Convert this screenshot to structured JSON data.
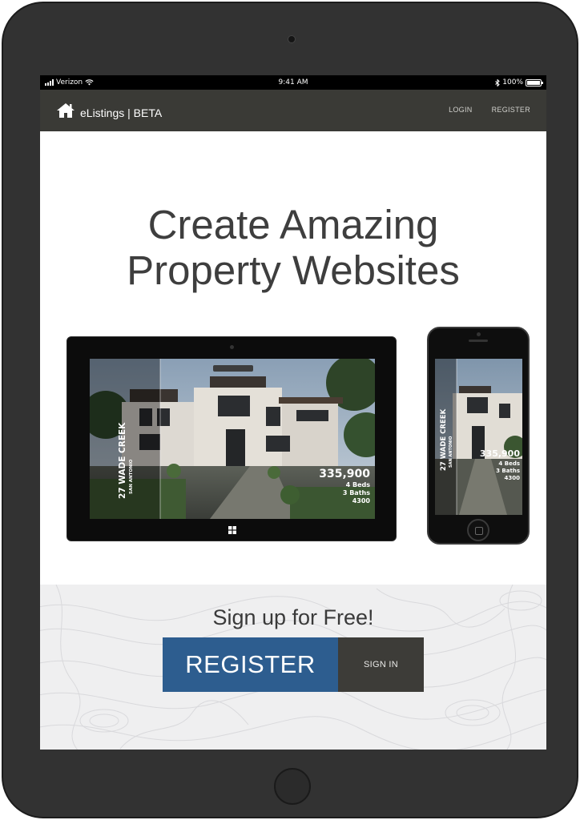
{
  "status_bar": {
    "carrier": "Verizon",
    "time": "9:41 AM",
    "battery": "100%",
    "battery_level": 1.0
  },
  "navbar": {
    "brand": "eListings | BETA",
    "brand_icon": "home-icon",
    "links": [
      "LOGIN",
      "REGISTER"
    ]
  },
  "hero": {
    "title_line1": "Create Amazing",
    "title_line2": "Property Websites"
  },
  "listing_preview": {
    "address": "27 WADE CREEK",
    "city": "SAN ANTONIO",
    "price": "335,900",
    "beds": "4 Beds",
    "baths": "3 Baths",
    "sqft": "4300"
  },
  "signup": {
    "title": "Sign up for Free!",
    "register_label": "REGISTER",
    "signin_label": "SIGN IN"
  },
  "colors": {
    "tablet_frame": "#323232",
    "navbar": "#3a3a36",
    "register_button": "#2d5d8f",
    "signin_button": "#3d3c38",
    "signup_background": "#efeff0"
  }
}
